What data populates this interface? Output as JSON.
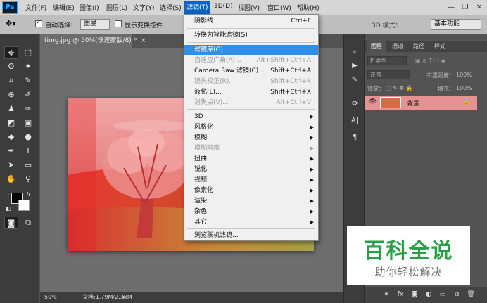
{
  "app": {
    "logo": "Ps"
  },
  "menubar": {
    "items": [
      "文件(F)",
      "编辑(E)",
      "图像(I)",
      "图层(L)",
      "文字(Y)",
      "选择(S)",
      "滤镜(T)",
      "3D(D)",
      "视图(V)",
      "窗口(W)",
      "帮助(H)"
    ],
    "active": "滤镜(T)",
    "window_controls": {
      "minimize": "—",
      "restore": "❐",
      "close": "✕"
    }
  },
  "options": {
    "auto_select_label": "自动选择：",
    "auto_select_checked": true,
    "auto_select_target": "图层",
    "transform_label": "显示变换控件",
    "transform_checked": false,
    "mode_3d_label": "3D 模式：",
    "workspace": "基本功能"
  },
  "document": {
    "tab_title": "timg.jpg @ 50%(快速蒙版/8) *",
    "tab_close": "×",
    "zoom": "50%",
    "doc_size": "文档:1.79M/2.38M"
  },
  "filter_menu": {
    "items": [
      {
        "label": "阴影线",
        "shortcut": "Ctrl+F",
        "disabled": false
      },
      {
        "separator": true
      },
      {
        "label": "转换为智能滤镜(S)",
        "disabled": false
      },
      {
        "separator": true
      },
      {
        "label": "滤镜库(G)...",
        "disabled": false,
        "highlight": true
      },
      {
        "label": "自适应广角(A)...",
        "shortcut": "Alt+Shift+Ctrl+A",
        "disabled": true
      },
      {
        "label": "Camera Raw 滤镜(C)...",
        "shortcut": "Shift+Ctrl+A",
        "disabled": false
      },
      {
        "label": "镜头校正(R)...",
        "shortcut": "Shift+Ctrl+R",
        "disabled": true
      },
      {
        "label": "液化(L)...",
        "shortcut": "Shift+Ctrl+X",
        "disabled": false
      },
      {
        "label": "消失点(V)...",
        "shortcut": "Alt+Ctrl+V",
        "disabled": true
      },
      {
        "separator": true
      },
      {
        "label": "3D",
        "submenu": true,
        "disabled": false
      },
      {
        "label": "风格化",
        "submenu": true,
        "disabled": false
      },
      {
        "label": "模糊",
        "submenu": true,
        "disabled": false
      },
      {
        "label": "模糊画廊",
        "submenu": true,
        "disabled": true
      },
      {
        "label": "扭曲",
        "submenu": true,
        "disabled": false
      },
      {
        "label": "锐化",
        "submenu": true,
        "disabled": false
      },
      {
        "label": "视频",
        "submenu": true,
        "disabled": false
      },
      {
        "label": "像素化",
        "submenu": true,
        "disabled": false
      },
      {
        "label": "渲染",
        "submenu": true,
        "disabled": false
      },
      {
        "label": "杂色",
        "submenu": true,
        "disabled": false
      },
      {
        "label": "其它",
        "submenu": true,
        "disabled": false
      },
      {
        "separator": true
      },
      {
        "label": "浏览联机滤镜...",
        "disabled": false
      }
    ]
  },
  "panel": {
    "tabs": [
      "图层",
      "通道",
      "路径",
      "样式"
    ],
    "active_tab": "图层",
    "kind_filter": "P 类型",
    "blend_mode": "正常",
    "opacity_label": "不透明度：",
    "opacity_value": "100%",
    "lock_label": "锁定：",
    "fill_label": "填充：",
    "fill_value": "100%",
    "layer_name": "背景"
  },
  "watermark": {
    "title": "百科全说",
    "subtitle": "助你轻松解决"
  },
  "colors": {
    "menu_highlight": "#2e8fe8",
    "active_menu": "#0a64c4",
    "layer_selected": "#e49292",
    "watermark_green": "#27a046",
    "quickmask_overlay": "#e83a3a"
  }
}
